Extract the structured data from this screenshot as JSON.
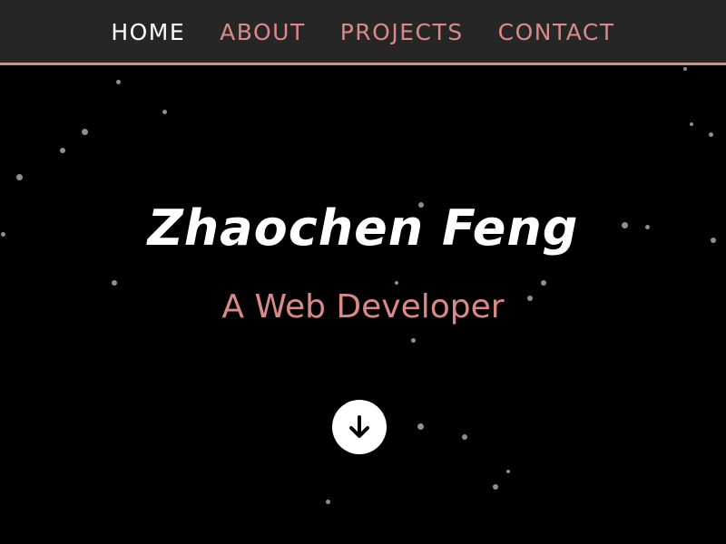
{
  "nav": {
    "items": [
      {
        "label": "HOME",
        "active": true
      },
      {
        "label": "ABOUT",
        "active": false
      },
      {
        "label": "PROJECTS",
        "active": false
      },
      {
        "label": "CONTACT",
        "active": false
      }
    ]
  },
  "hero": {
    "title": "Zhaochen Feng",
    "subtitle": "A Web Developer",
    "scroll_icon": "arrow-down-circle-icon"
  },
  "colors": {
    "background": "#000000",
    "navbar": "#262626",
    "accent": "#d98a87",
    "text": "#ffffff",
    "star": "#8f8f8f"
  }
}
